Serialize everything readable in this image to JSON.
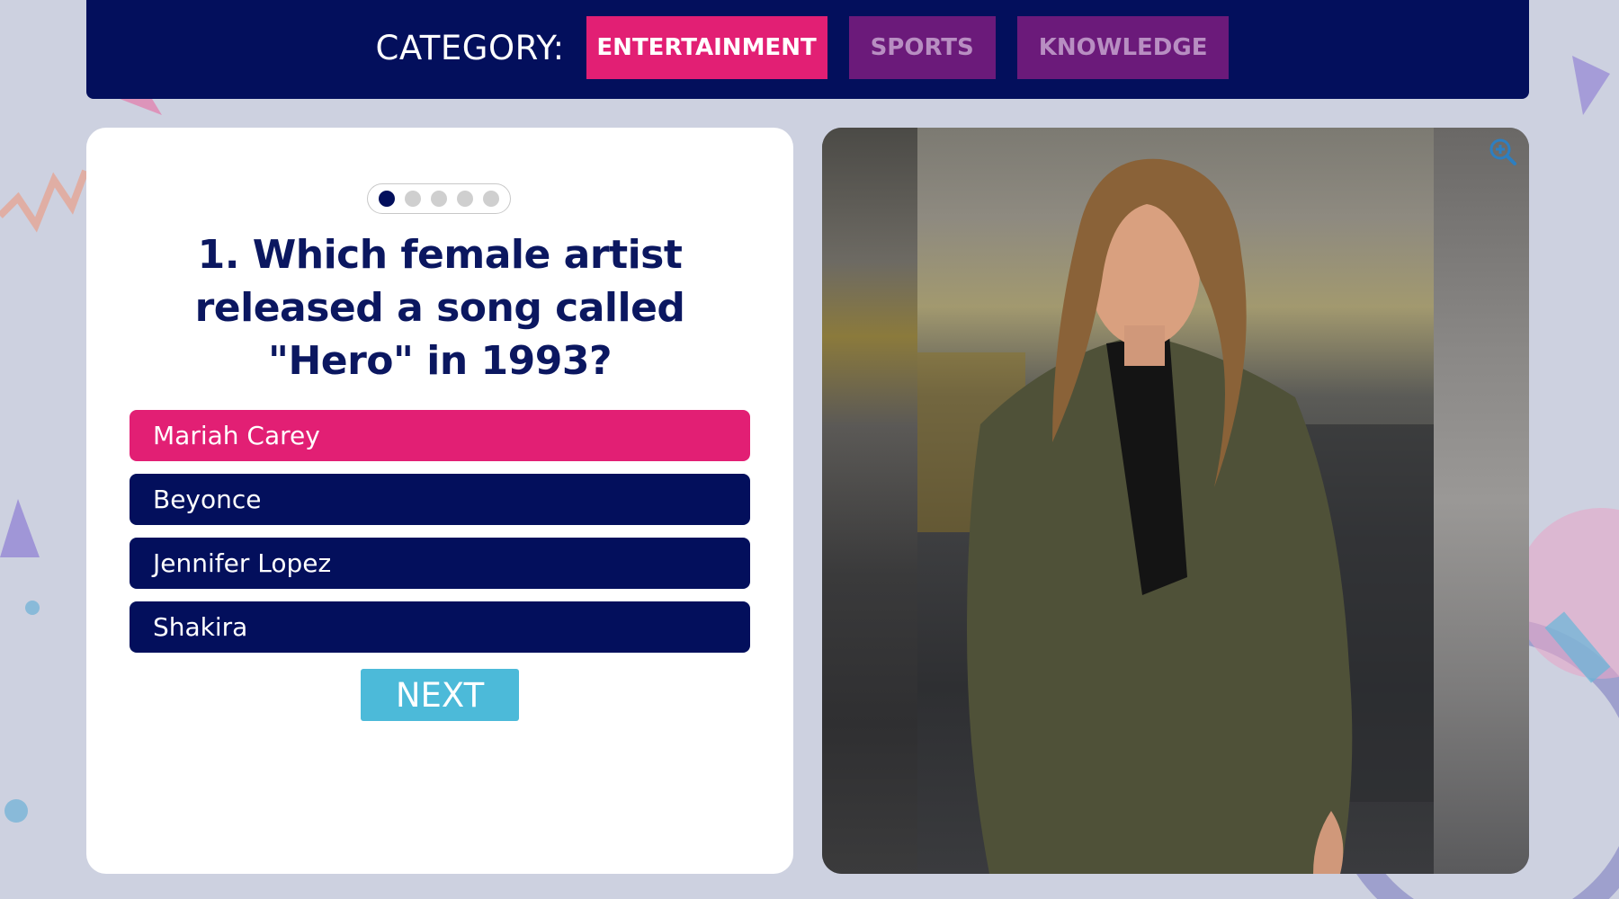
{
  "header": {
    "category_label": "CATEGORY:",
    "categories": [
      {
        "label": "ENTERTAINMENT",
        "active": true
      },
      {
        "label": "SPORTS",
        "active": false
      },
      {
        "label": "KNOWLEDGE",
        "active": false
      }
    ]
  },
  "quiz": {
    "progress": {
      "current": 1,
      "total": 5
    },
    "question": "1. Which female artist released a song called \"Hero\" in 1993?",
    "answers": [
      {
        "label": "Mariah Carey",
        "selected": true
      },
      {
        "label": "Beyonce",
        "selected": false
      },
      {
        "label": "Jennifer Lopez",
        "selected": false
      },
      {
        "label": "Shakira",
        "selected": false
      }
    ],
    "next_label": "NEXT"
  },
  "image_panel": {
    "icon": "zoom-in-icon"
  },
  "colors": {
    "navy": "#030f5c",
    "pink": "#e21f74",
    "purple": "#6b1a7a",
    "cyan": "#4cbad9",
    "background": "#cdd1e0"
  }
}
